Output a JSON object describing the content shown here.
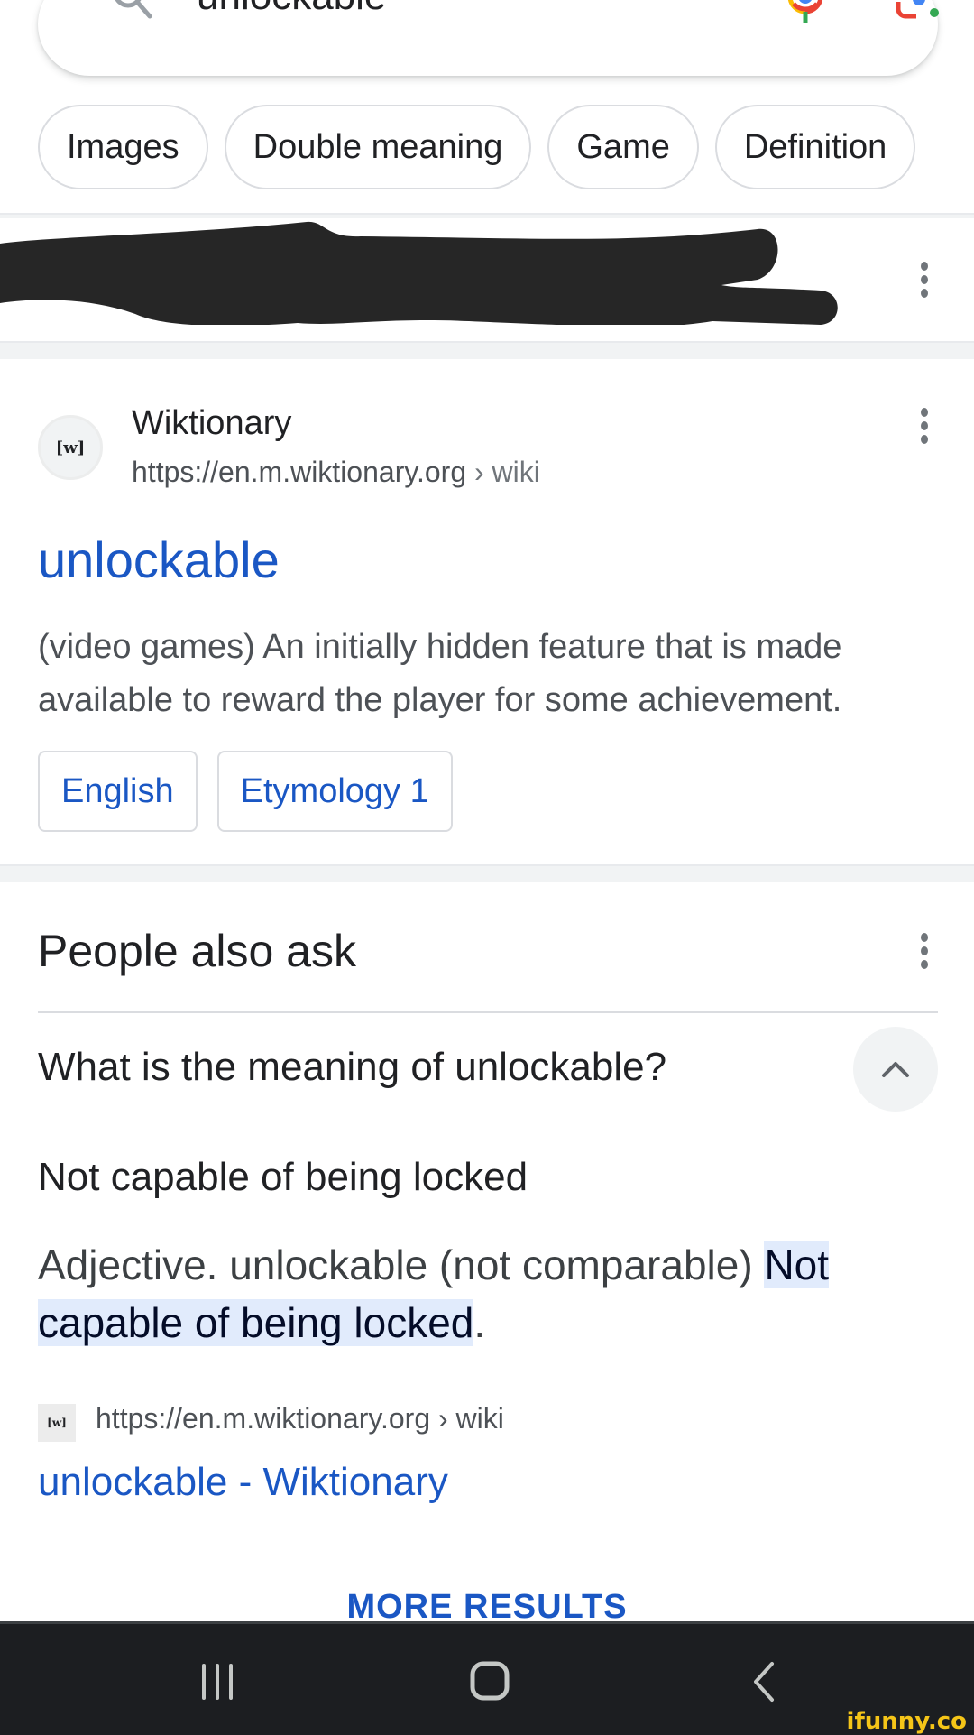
{
  "search": {
    "query": "unlockable",
    "icons": {
      "search": "search-icon",
      "voice": "mic-icon",
      "lens": "google-lens-icon"
    }
  },
  "chips": [
    {
      "label": "Images"
    },
    {
      "label": "Double meaning"
    },
    {
      "label": "Game"
    },
    {
      "label": "Definition"
    }
  ],
  "redacted_result": {
    "menu_icon": "more-vert-icon"
  },
  "wiktionary_result": {
    "favicon_text": "[w]",
    "site_name": "Wiktionary",
    "url": "https://en.m.wiktionary.org",
    "breadcrumb": "› wiki",
    "title": "unlockable",
    "snippet": "(video games) An initially hidden feature that is made available to reward the player for some achievement.",
    "sublinks": [
      {
        "label": "English"
      },
      {
        "label": "Etymology 1"
      }
    ]
  },
  "people_also_ask": {
    "title": "People also ask",
    "question": "What is the meaning of unlockable?",
    "expanded": true,
    "answer_heading": "Not capable of being locked",
    "answer_prefix": "Adjective. unlockable (not comparable) ",
    "answer_highlight": "Not capable of being locked",
    "answer_suffix": ".",
    "source_favicon_text": "[w]",
    "source_url": "https://en.m.wiktionary.org › wiki",
    "source_title": "unlockable - Wiktionary"
  },
  "more_results_label": "MORE RESULTS",
  "navbar": {
    "recents": "recent-apps-icon",
    "home": "home-icon",
    "back": "back-icon"
  },
  "watermark": "ifunny.co",
  "colors": {
    "link_blue": "#1a57c4",
    "text_primary": "#202124",
    "text_secondary": "#4d5156",
    "highlight_bg": "#e1ebfc",
    "navbar_bg": "#1c1e21",
    "google_blue": "#4285f4",
    "google_red": "#ea4335",
    "google_yellow": "#fbbc04",
    "google_green": "#34a853"
  }
}
